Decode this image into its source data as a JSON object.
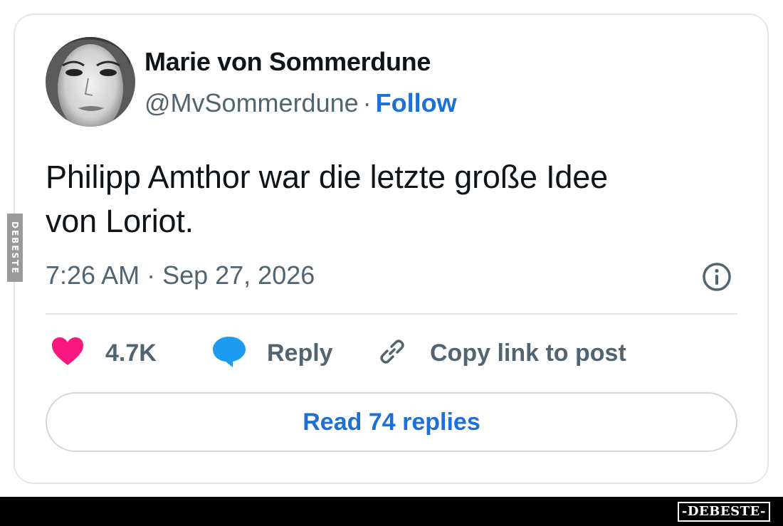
{
  "tweet": {
    "author": {
      "name": "Marie von Sommerdune",
      "handle": "@MvSommerdune",
      "separator": "·",
      "follow_label": "Follow"
    },
    "text_line1": "Philipp Amthor war die letzte große Idee",
    "text_line2": "von Loriot.",
    "timestamp": "7:26 AM · Sep 27, 2026",
    "actions": {
      "like_count": "4.7K",
      "reply_label": "Reply",
      "copy_label": "Copy link to post"
    },
    "read_replies_label": "Read 74 replies"
  },
  "icons": {
    "like": "heart-icon",
    "reply": "speech-bubble-icon",
    "copy": "link-icon",
    "info": "info-icon"
  },
  "watermark": {
    "side_text": "DEBESTE",
    "footer_logo": "-DEBESTE-"
  },
  "colors": {
    "text_primary": "#0f1419",
    "text_secondary": "#536471",
    "link_blue": "#1d70d6",
    "heart_pink": "#f91880",
    "reply_blue": "#1d9bf0",
    "border": "#e1e8ed"
  }
}
